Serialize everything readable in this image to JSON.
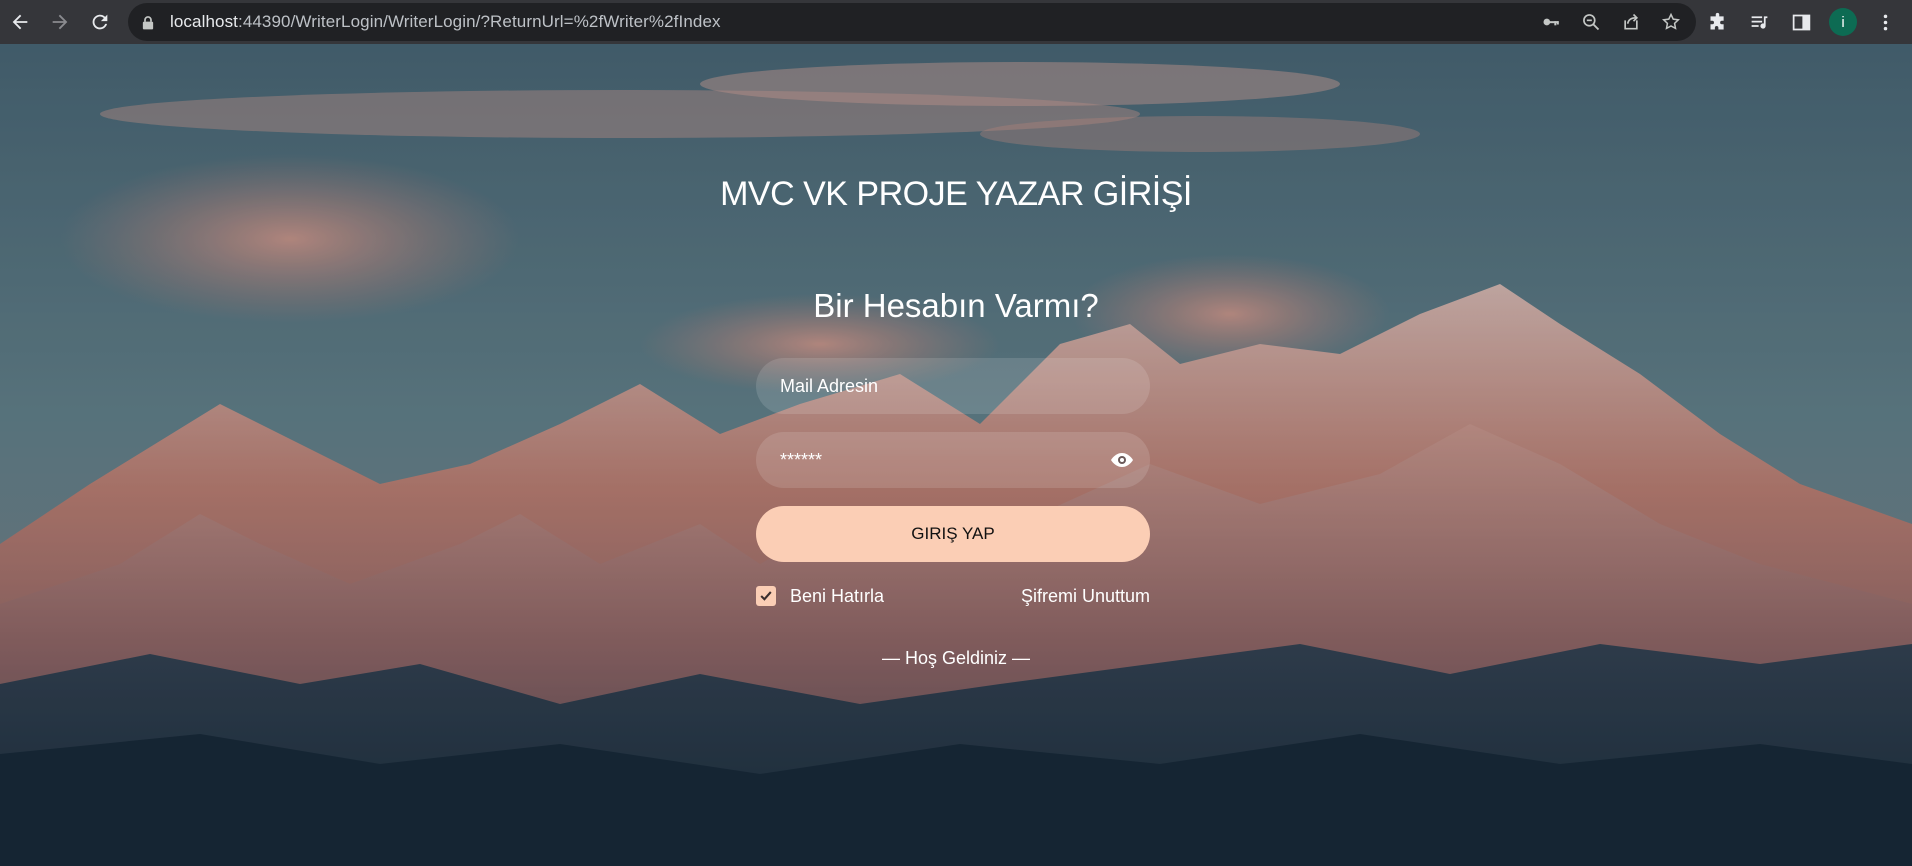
{
  "browser": {
    "url_host": "localhost",
    "url_rest": ":44390/WriterLogin/WriterLogin/?ReturnUrl=%2fWriter%2fIndex",
    "profile_initial": "i"
  },
  "login": {
    "title": "MVC VK PROJE YAZAR GİRİŞİ",
    "subtitle": "Bir Hesabın Varmı?",
    "mail_placeholder": "Mail Adresin",
    "password_value": "******",
    "button_label": "GIRIŞ YAP",
    "remember_label": "Beni Hatırla",
    "remember_checked": true,
    "forgot_label": "Şifremi Unuttum",
    "welcome_text": "— Hoş Geldiniz —"
  },
  "colors": {
    "accent": "#fbceb5",
    "chrome_bg": "#35363a",
    "omnibox_bg": "#202124",
    "avatar_bg": "#0d6b53"
  }
}
